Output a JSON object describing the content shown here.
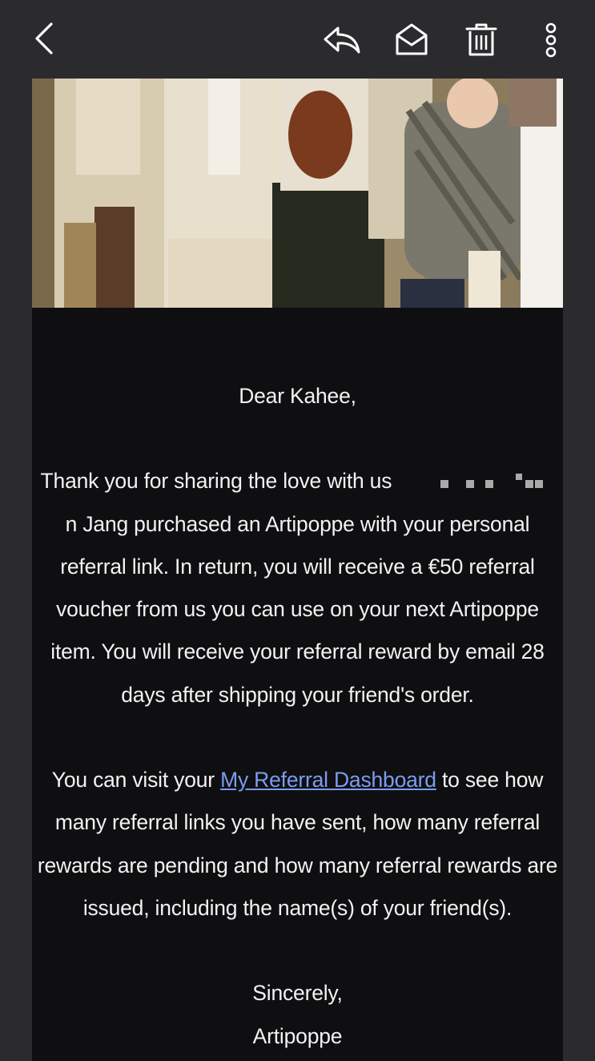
{
  "toolbar": {
    "back_icon": "chevron-left-icon",
    "reply_icon": "reply-icon",
    "mark_unread_icon": "envelope-open-icon",
    "delete_icon": "trash-icon",
    "more_icon": "more-vertical-icon"
  },
  "email": {
    "hero_image": "photo of people in light-colored outfits carrying babies in Artipoppe carriers",
    "greeting": "Dear Kahee,",
    "para1_start": "Thank you for sharing the love with us",
    "para1_end": "n Jang purchased an Artipoppe with your personal referral link. In return, you will receive a €50 referral voucher from us you can use on your next Artipoppe item. You will receive your referral reward by email 28 days after shipping your friend's order.",
    "para2_start": "You can visit your",
    "para2_link": "My Referral Dashboard",
    "para2_end": "to see how many referral links you have sent, how many referral rewards are pending and how many referral rewards are issued, including the name(s) of your friend(s).",
    "closing": "Sincerely,",
    "signature": "Artipoppe"
  },
  "colors": {
    "toolbar_bg": "#2b2b2e",
    "email_bg": "#0f0f11",
    "text": "#f2f2f2",
    "link": "#7d9cf0"
  }
}
